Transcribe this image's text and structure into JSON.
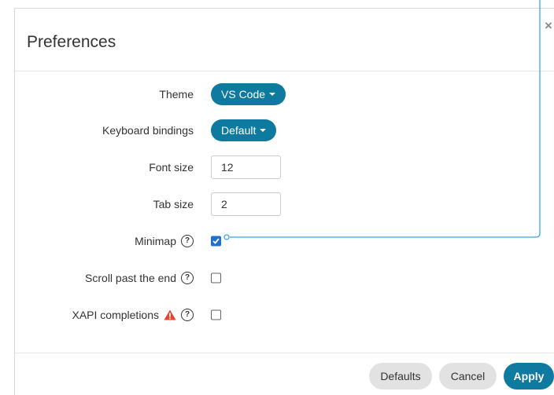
{
  "dialog": {
    "title": "Preferences",
    "close_label": "×"
  },
  "form": {
    "theme": {
      "label": "Theme",
      "value": "VS Code"
    },
    "keyboard": {
      "label": "Keyboard bindings",
      "value": "Default"
    },
    "font_size": {
      "label": "Font size",
      "value": "12"
    },
    "tab_size": {
      "label": "Tab size",
      "value": "2"
    },
    "minimap": {
      "label": "Minimap",
      "checked": true
    },
    "scroll_past_end": {
      "label": "Scroll past the end",
      "checked": false
    },
    "xapi_completions": {
      "label": "XAPI completions",
      "checked": false
    }
  },
  "footer": {
    "defaults_label": "Defaults",
    "cancel_label": "Cancel",
    "apply_label": "Apply"
  },
  "icons": {
    "help": "help-circle-icon",
    "warning": "warning-triangle-icon",
    "close": "close-icon",
    "caret": "caret-down-icon",
    "check": "checkmark-icon"
  },
  "colors": {
    "accent": "#0e7aa0",
    "checkbox_checked": "#1f6fd1",
    "warning": "#e8432f",
    "connector": "#3aa6d8",
    "secondary_button": "#e2e2e2"
  }
}
